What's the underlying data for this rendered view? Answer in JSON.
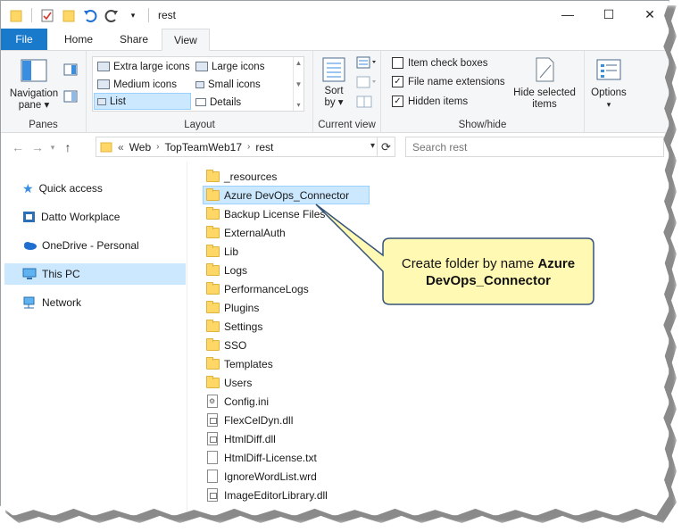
{
  "window": {
    "title": "rest",
    "controls": [
      "—",
      "☐",
      "✕"
    ]
  },
  "ribbon_tabs": [
    {
      "label": "File"
    },
    {
      "label": "Home"
    },
    {
      "label": "Share"
    },
    {
      "label": "View"
    }
  ],
  "ribbon": {
    "panes": {
      "navigation_pane_label": "Navigation",
      "navigation_pane_label2": "pane",
      "group_label": "Panes"
    },
    "layout": {
      "items": [
        {
          "label": "Extra large icons"
        },
        {
          "label": "Large icons"
        },
        {
          "label": "Medium icons"
        },
        {
          "label": "Small icons"
        },
        {
          "label": "List"
        },
        {
          "label": "Details"
        }
      ],
      "selected": "List",
      "group_label": "Layout"
    },
    "current_view": {
      "sort_label": "Sort",
      "sort_label2": "by",
      "group_label": "Current view"
    },
    "show_hide": {
      "item_check_boxes": {
        "label": "Item check boxes",
        "checked": false
      },
      "file_name_extensions": {
        "label": "File name extensions",
        "checked": true
      },
      "hidden_items": {
        "label": "Hidden items",
        "checked": true
      },
      "hide_selected_label": "Hide selected",
      "hide_selected_label2": "items",
      "group_label": "Show/hide"
    },
    "options_label": "Options"
  },
  "address": {
    "overflow": "«",
    "crumbs": [
      "Web",
      "TopTeamWeb17",
      "rest"
    ],
    "search_placeholder": "Search rest"
  },
  "nav_pane": [
    {
      "label": "Quick access",
      "icon": "star-icon"
    },
    {
      "label": "Datto Workplace",
      "icon": "cloud-drive-icon"
    },
    {
      "label": "OneDrive - Personal",
      "icon": "onedrive-icon"
    },
    {
      "label": "This PC",
      "icon": "computer-icon",
      "selected": true
    },
    {
      "label": "Network",
      "icon": "network-icon"
    }
  ],
  "files": [
    {
      "name": "_resources",
      "type": "folder"
    },
    {
      "name": "Azure DevOps_Connector",
      "type": "folder",
      "selected": true
    },
    {
      "name": "Backup License Files",
      "type": "folder"
    },
    {
      "name": "ExternalAuth",
      "type": "folder"
    },
    {
      "name": "Lib",
      "type": "folder"
    },
    {
      "name": "Logs",
      "type": "folder"
    },
    {
      "name": "PerformanceLogs",
      "type": "folder"
    },
    {
      "name": "Plugins",
      "type": "folder"
    },
    {
      "name": "Settings",
      "type": "folder"
    },
    {
      "name": "SSO",
      "type": "folder"
    },
    {
      "name": "Templates",
      "type": "folder"
    },
    {
      "name": "Users",
      "type": "folder"
    },
    {
      "name": "Config.ini",
      "type": "config"
    },
    {
      "name": "FlexCelDyn.dll",
      "type": "dll"
    },
    {
      "name": "HtmlDiff.dll",
      "type": "dll"
    },
    {
      "name": "HtmlDiff-License.txt",
      "type": "text"
    },
    {
      "name": "IgnoreWordList.wrd",
      "type": "text"
    },
    {
      "name": "ImageEditorLibrary.dll",
      "type": "dll"
    }
  ],
  "callout": {
    "text_plain": "Create folder by name ",
    "text_bold": "Azure DevOps_Connector"
  },
  "colors": {
    "file_tab": "#1979ca",
    "selection": "#cce8ff",
    "callout_fill": "#fff9b3",
    "callout_border": "#33527a"
  }
}
